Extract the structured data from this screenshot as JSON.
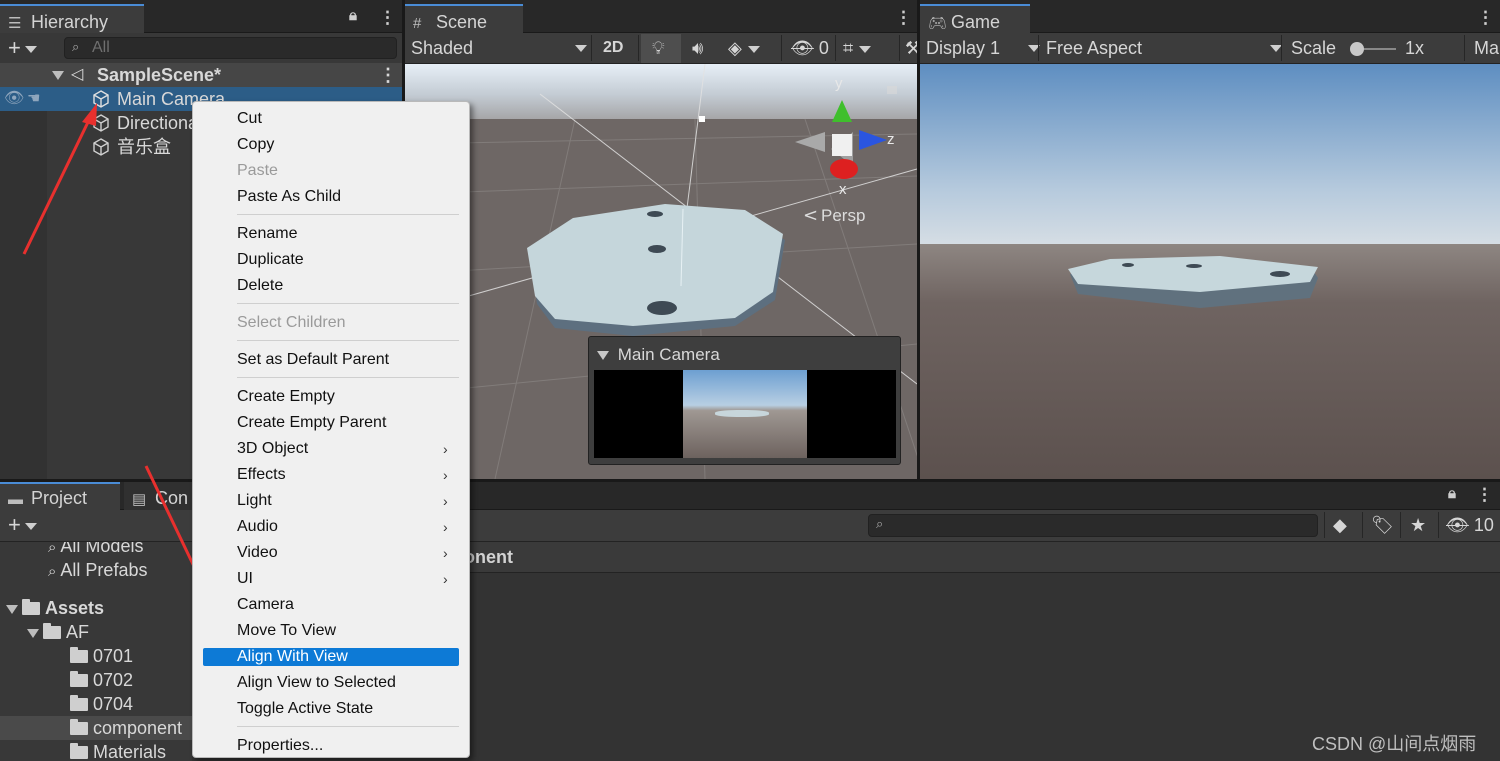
{
  "hierarchy": {
    "tab_label": "Hierarchy",
    "search_placeholder": "All",
    "scene_name": "SampleScene*",
    "items": [
      {
        "label": "Main Camera"
      },
      {
        "label": "Directional Light"
      },
      {
        "label": "音乐盒"
      }
    ]
  },
  "scene": {
    "tab_label": "Scene",
    "shading_mode": "Shaded",
    "toggle_2d": "2D",
    "hidden_count": "0",
    "gizmo_axes": {
      "y": "y",
      "z": "z",
      "x": "x"
    },
    "projection_label": "Persp",
    "camera_preview_title": "Main Camera"
  },
  "game": {
    "tab_label": "Game",
    "display": "Display 1",
    "aspect": "Free Aspect",
    "scale_label": "Scale",
    "scale_value": "1x",
    "maximize_label": "Ma"
  },
  "project": {
    "tab_project": "Project",
    "tab_console": "Con",
    "hidden_count": "10",
    "breadcrumb_fragment": "onent",
    "tree": [
      {
        "label": "All Models",
        "type": "search"
      },
      {
        "label": "All Prefabs",
        "type": "search"
      },
      {
        "label": "Assets",
        "type": "folder-open"
      },
      {
        "label": "AF",
        "type": "folder-open"
      },
      {
        "label": "0701",
        "type": "folder"
      },
      {
        "label": "0702",
        "type": "folder"
      },
      {
        "label": "0704",
        "type": "folder"
      },
      {
        "label": "component",
        "type": "folder"
      },
      {
        "label": "Materials",
        "type": "folder"
      }
    ]
  },
  "context_menu": {
    "items": [
      {
        "label": "Cut"
      },
      {
        "label": "Copy"
      },
      {
        "label": "Paste"
      },
      {
        "label": "Paste As Child"
      },
      {
        "label": "Rename"
      },
      {
        "label": "Duplicate"
      },
      {
        "label": "Delete"
      },
      {
        "label": "Select Children"
      },
      {
        "label": "Set as Default Parent"
      },
      {
        "label": "Create Empty"
      },
      {
        "label": "Create Empty Parent"
      },
      {
        "label": "3D Object"
      },
      {
        "label": "Effects"
      },
      {
        "label": "Light"
      },
      {
        "label": "Audio"
      },
      {
        "label": "Video"
      },
      {
        "label": "UI"
      },
      {
        "label": "Camera"
      },
      {
        "label": "Move To View"
      },
      {
        "label": "Align With View"
      },
      {
        "label": "Align View to Selected"
      },
      {
        "label": "Toggle Active State"
      },
      {
        "label": "Properties..."
      }
    ],
    "highlighted": "Align With View",
    "disabled": [
      "Paste",
      "Select Children"
    ],
    "submenus": [
      "3D Object",
      "Effects",
      "Light",
      "Audio",
      "Video",
      "UI"
    ]
  },
  "watermark": "CSDN @山间点烟雨",
  "colors": {
    "accent": "#0d7ad6",
    "selection": "#2c5d87",
    "annotation_arrow": "#e8302e"
  }
}
